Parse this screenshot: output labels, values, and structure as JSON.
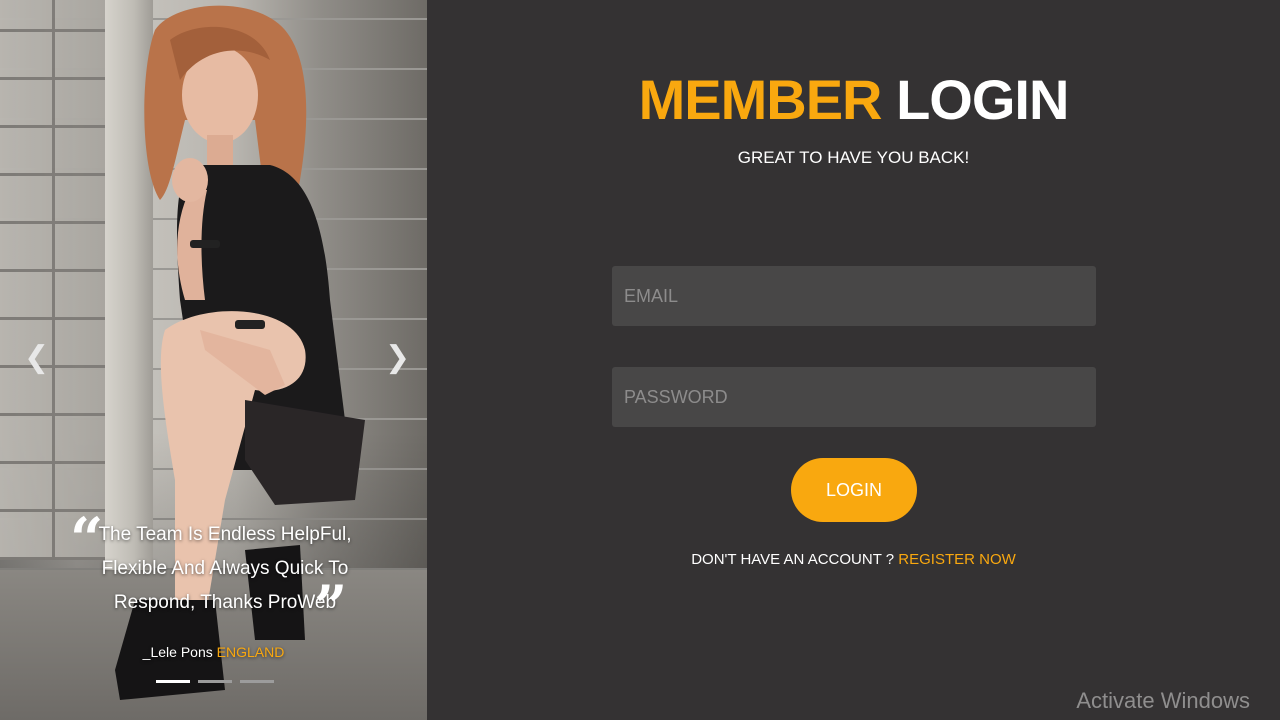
{
  "carousel": {
    "prev_icon": "chevron-left-icon",
    "next_icon": "chevron-right-icon",
    "prev_glyph": "❮",
    "next_glyph": "❯",
    "quote_open": "“",
    "quote_close": "”",
    "testimonial_lines": [
      "The Team Is Endless HelpFul,",
      "Flexible And Always Quick To",
      "Respond, Thanks ProWeb"
    ],
    "author_name": "_Lele Pons",
    "author_country": "ENGLAND",
    "slides_count": 3,
    "active_slide": 1
  },
  "login": {
    "title_part1": "MEMBER",
    "title_part2": "LOGIN",
    "subtitle": "GREAT TO HAVE YOU BACK!",
    "email_placeholder": "EMAIL",
    "password_placeholder": "PASSWORD",
    "login_label": "LOGIN",
    "register_prompt": "DON'T HAVE AN ACCOUNT ?",
    "register_link": "REGISTER NOW"
  },
  "os": {
    "watermark": "Activate Windows"
  },
  "colors": {
    "accent": "#f9a80f",
    "panel_bg": "#343233",
    "input_bg": "#484747"
  }
}
